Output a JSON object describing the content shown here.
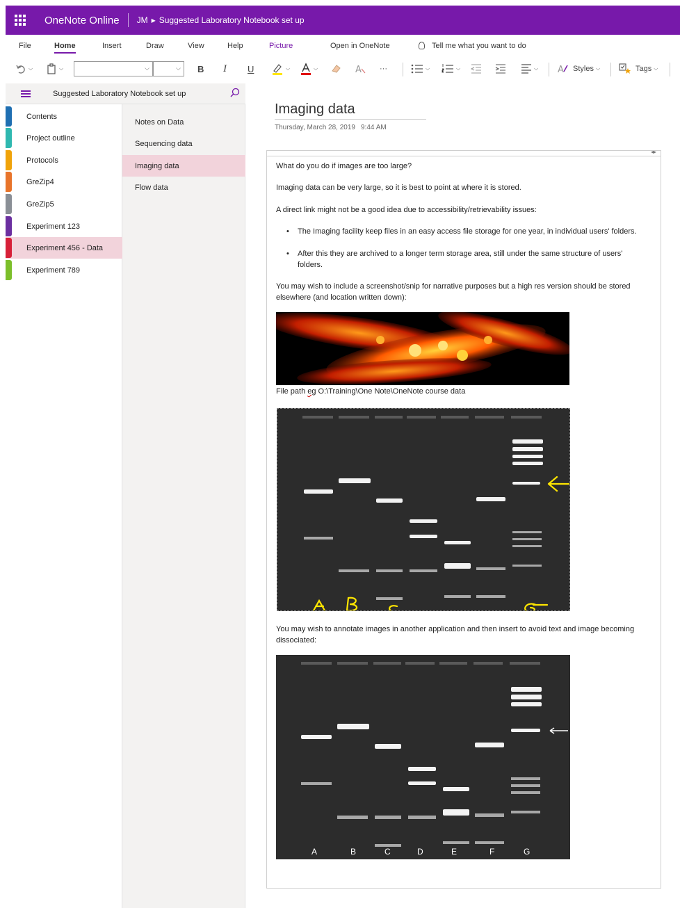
{
  "titlebar": {
    "app_name": "OneNote Online",
    "user_initials": "JM",
    "notebook": "Suggested Laboratory Notebook set up"
  },
  "ribbon": {
    "tabs": [
      "File",
      "Home",
      "Insert",
      "Draw",
      "View",
      "Help",
      "Picture",
      "Open in OneNote"
    ],
    "active_tab": "Home",
    "tell_me": "Tell me what you want to do",
    "styles_label": "Styles",
    "tags_label": "Tags",
    "bold": "B",
    "italic": "I",
    "underline": "U",
    "more": "···"
  },
  "nav": {
    "notebook_title": "Suggested Laboratory Notebook set up",
    "sections": [
      {
        "label": "Contents",
        "color": "#1f6fb2"
      },
      {
        "label": "Project outline",
        "color": "#2fb8b0"
      },
      {
        "label": "Protocols",
        "color": "#f0a30a"
      },
      {
        "label": "GreZip4",
        "color": "#e8742a"
      },
      {
        "label": "GreZip5",
        "color": "#8a8f96"
      },
      {
        "label": "Experiment 123",
        "color": "#6b2fa0"
      },
      {
        "label": "Experiment 456 - Data",
        "color": "#d72038"
      },
      {
        "label": "Experiment 789",
        "color": "#7cbf2a"
      }
    ],
    "selected_section": 6,
    "pages": [
      "Notes on Data",
      "Sequencing data",
      "Imaging data",
      "Flow data"
    ],
    "selected_page": 2
  },
  "page": {
    "title": "Imaging data",
    "date": "Thursday, March 28, 2019",
    "time": "9:44 AM",
    "p1": "What do you do if images are too large?",
    "p2": "Imaging data can be very large, so it is best to point at where it is stored.",
    "p3": "A direct link might not be a good idea due to accessibility/retrievability issues:",
    "bullet1": "The Imaging facility keep files in an easy access file storage for one year, in individual users' folders.",
    "bullet2": "After this they are archived to a longer term storage area, still under the same structure of users' folders.",
    "p4": "You may wish to include a screenshot/snip for narrative purposes but a high res version should be stored elsewhere (and location written down):",
    "filepath_prefix": "File path ",
    "filepath_eg": "eg",
    "filepath": " O:\\Training\\One Note\\OneNote course data",
    "p5": "You may wish to annotate images in another application and then insert to avoid text and image becoming dissociated:",
    "gel1_labels": [
      "A",
      "B",
      "C",
      "G"
    ],
    "gel2_labels": [
      "A",
      "B",
      "C",
      "D",
      "E",
      "F",
      "G"
    ]
  },
  "colors": {
    "brand": "#7719aa",
    "selection": "#f2d3db",
    "annotation": "#ffe600"
  }
}
